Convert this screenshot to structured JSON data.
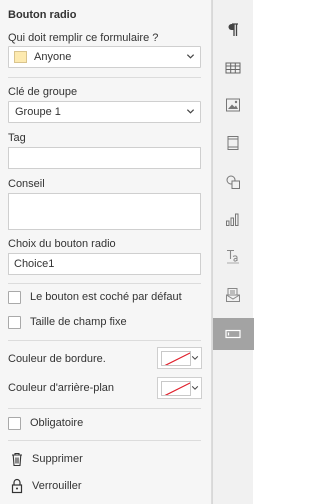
{
  "panel": {
    "title": "Bouton radio",
    "who_fills_label": "Qui doit remplir ce formulaire ?",
    "who_fills_value": "Anyone",
    "group_key_label": "Clé de groupe",
    "group_key_value": "Groupe 1",
    "tag_label": "Tag",
    "tag_value": "",
    "tip_label": "Conseil",
    "tip_value": "",
    "choice_label": "Choix du bouton radio",
    "choice_value": "Choice1",
    "checked_default_label": "Le bouton est coché par défaut",
    "fixed_size_label": "Taille de champ fixe",
    "border_color_label": "Couleur de bordure.",
    "background_color_label": "Couleur d'arrière-plan",
    "required_label": "Obligatoire",
    "delete_label": "Supprimer",
    "lock_label": "Verrouiller"
  },
  "colors": {
    "swatch_yellow": "#fdeab0",
    "no_color_line": "#e0202c",
    "active_rail": "#a3a3a3"
  },
  "rail": {
    "icons": [
      "paragraph-icon",
      "table-icon",
      "image-icon",
      "header-footer-icon",
      "shape-icon",
      "chart-icon",
      "text-art-icon",
      "mail-merge-icon",
      "form-field-icon"
    ],
    "active": "form-field-icon"
  }
}
